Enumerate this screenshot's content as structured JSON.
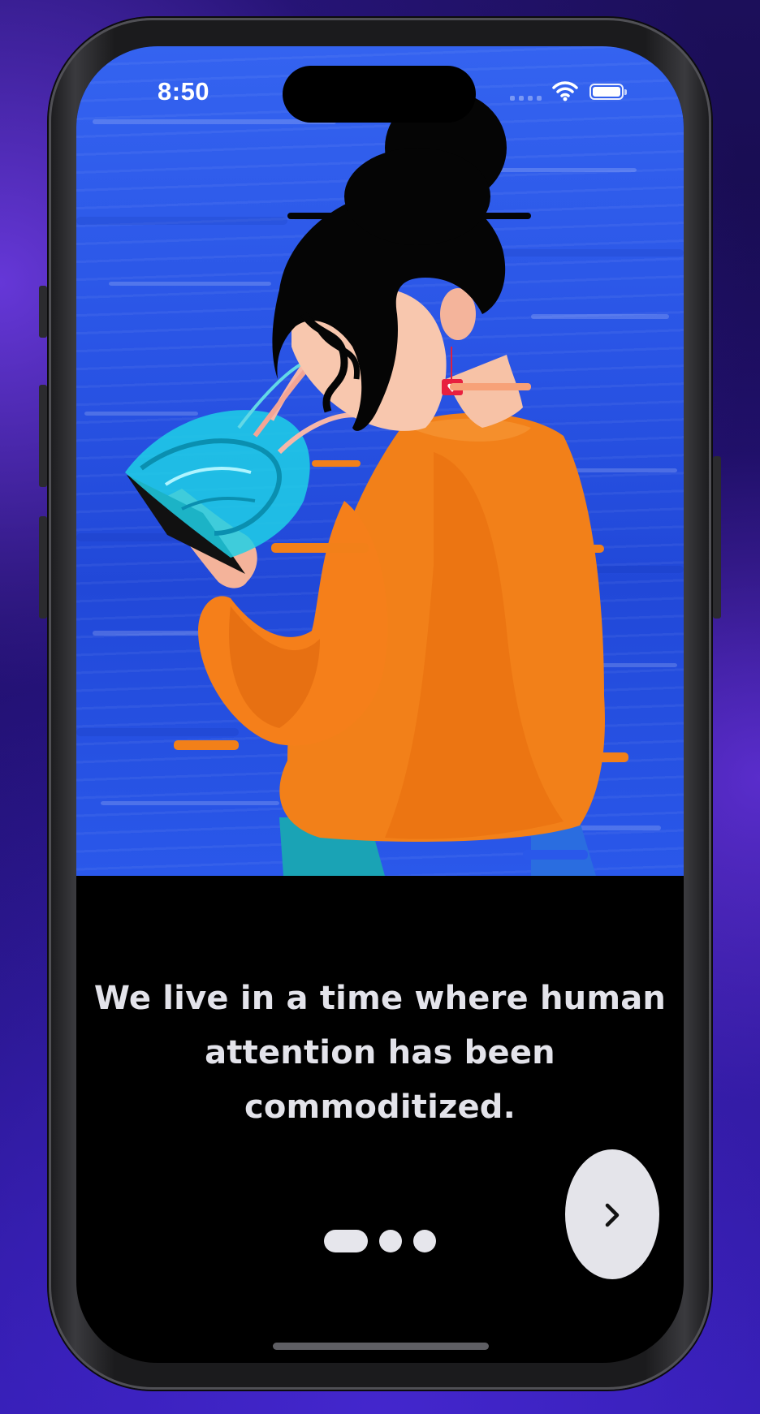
{
  "status_bar": {
    "time": "8:50",
    "icons": [
      "signal-icon",
      "wifi-icon",
      "battery-icon"
    ]
  },
  "hero": {
    "illustration": "woman-reading-phone-illustration",
    "background_color": "#2a55e6",
    "sweater_color": "#f28019"
  },
  "onboarding": {
    "caption_line1": "We live in a time where human",
    "caption_line2": "attention has been",
    "caption_line3": "commoditized.",
    "page_index": 1,
    "page_count": 3,
    "next_icon": "chevron-right-icon"
  },
  "colors": {
    "screen_background": "#000000",
    "caption_text": "#e3e3ea",
    "button_background": "#e4e4ea",
    "indicator_active": "#e6e6ec"
  }
}
